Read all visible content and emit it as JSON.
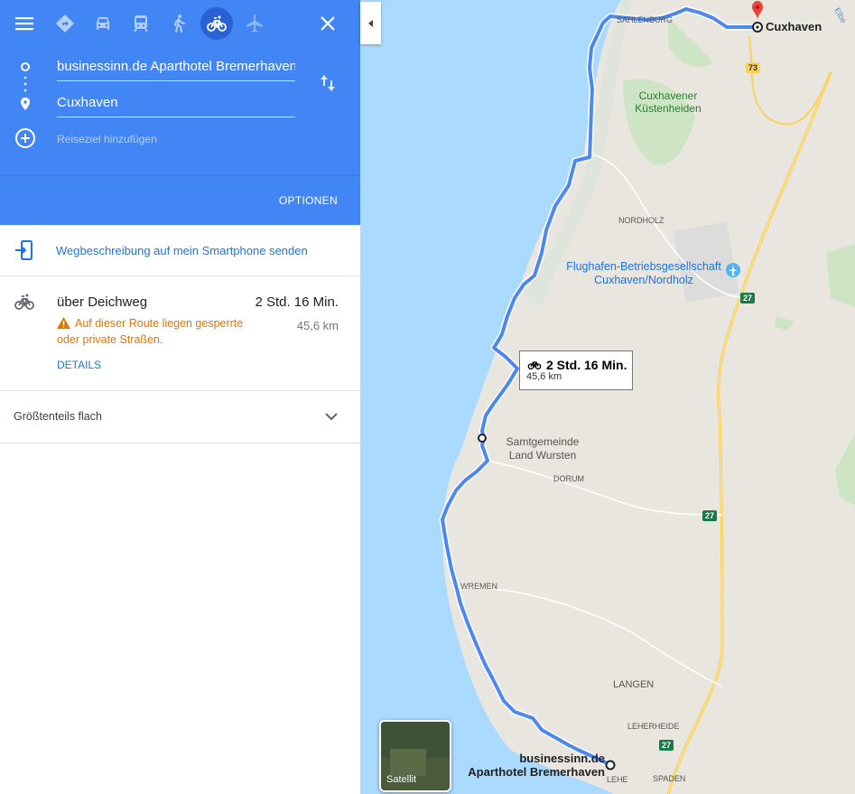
{
  "colors": {
    "header": "#4285f4",
    "link": "#1a73e8",
    "warning": "#e37400",
    "route": "#4d88f0"
  },
  "modes": [
    {
      "name": "directions-icon",
      "active": false
    },
    {
      "name": "car-icon",
      "active": false
    },
    {
      "name": "transit-icon",
      "active": false
    },
    {
      "name": "walk-icon",
      "active": false
    },
    {
      "name": "bicycle-icon",
      "active": true
    },
    {
      "name": "flight-icon",
      "active": false
    }
  ],
  "waypoints": {
    "origin": "businessinn.de Aparthotel Bremerhaven",
    "destination": "Cuxhaven",
    "add_placeholder": "Reiseziel hinzufügen"
  },
  "options_label": "OPTIONEN",
  "send_to_phone": "Wegbeschreibung auf mein Smartphone senden",
  "route": {
    "title": "über Deichweg",
    "duration": "2 Std. 16 Min.",
    "distance": "45,6 km",
    "warning": "Auf dieser Route liegen gesperrte oder private Straßen.",
    "details_label": "DETAILS"
  },
  "elevation": "Größtenteils flach",
  "map": {
    "callout": {
      "duration": "2 Std. 16 Min.",
      "distance": "45,6 km"
    },
    "labels": {
      "cuxhaven": "Cuxhaven",
      "sahlenburg": "SAHLENBURG",
      "kuestenheiden": "Cuxhavener Küstenheiden",
      "nordholz": "NORDHOLZ",
      "airport": "Flughafen-Betriebsgesellschaft Cuxhaven/Nordholz",
      "samtgemeinde": "Samtgemeinde Land Wursten",
      "dorum": "DORUM",
      "wremen": "WREMEN",
      "langen": "LANGEN",
      "leherheide": "LEHERHEIDE",
      "spaden": "SPADEN",
      "lehe": "LEHE",
      "origin": "businessinn.de Aparthotel Bremerhaven",
      "elbe": "Elbe"
    },
    "roads": [
      "73",
      "27",
      "27",
      "27"
    ],
    "satellite_label": "Satellit"
  }
}
